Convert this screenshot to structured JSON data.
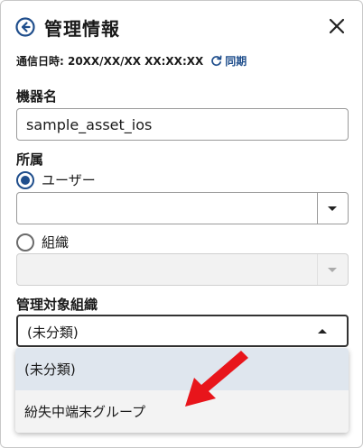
{
  "header": {
    "title": "管理情報",
    "back_icon": "back-circle-arrow-icon",
    "close_icon": "close-icon"
  },
  "sync": {
    "text": "通信日時: 20XX/XX/XX XX:XX:XX",
    "link_label": "同期",
    "icon": "refresh-icon"
  },
  "device_name": {
    "label": "機器名",
    "value": "sample_asset_ios"
  },
  "affiliation": {
    "label": "所属",
    "options": [
      {
        "label": "ユーザー",
        "checked": true
      },
      {
        "label": "組織",
        "checked": false
      }
    ]
  },
  "managed_org": {
    "label": "管理対象組織",
    "value": "(未分類)",
    "options": [
      "(未分類)",
      "紛失中端末グループ"
    ]
  },
  "colors": {
    "accent": "#1f4e8c",
    "annotation_arrow": "#e8151b"
  }
}
